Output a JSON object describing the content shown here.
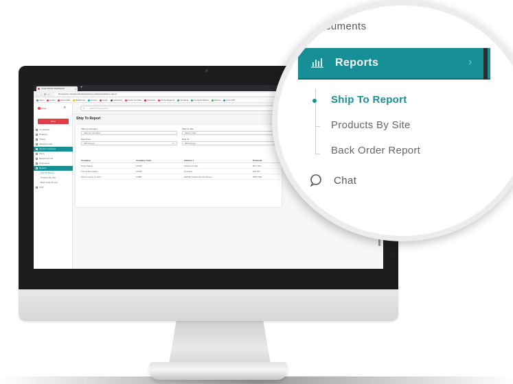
{
  "browser": {
    "tab_title": "Arrow Portal | Dashboard",
    "tab_close": "×",
    "new_tab": "+",
    "nav": [
      "←",
      "→",
      "⟳",
      "⌂"
    ],
    "url": "Not secure | arrowportal.designpixel.co.uk/reports/ship-to-report",
    "bookmarks": [
      {
        "label": "Apps",
        "color": "#4a8bf5"
      },
      {
        "label": "Arrow",
        "color": "#e23c4a"
      },
      {
        "label": "Arrow Mail",
        "color": "#e23c4a"
      },
      {
        "label": "MailChimp",
        "color": "#f5b400"
      },
      {
        "label": "Canva",
        "color": "#00b3c7"
      },
      {
        "label": "Gmail",
        "color": "#e23c4a"
      },
      {
        "label": "Facebook",
        "color": "#3b5998"
      },
      {
        "label": "Arrow YouTube",
        "color": "#e23c4a"
      },
      {
        "label": "Pinterest",
        "color": "#c8232c"
      },
      {
        "label": "Arrow Magento",
        "color": "#e23c4a"
      },
      {
        "label": "Contacts",
        "color": "#34a853"
      },
      {
        "label": "Contacts Master",
        "color": "#34a853"
      },
      {
        "label": "Sheets",
        "color": "#34a853"
      },
      {
        "label": "Free GPT",
        "color": "#10a37f"
      }
    ]
  },
  "app": {
    "logo": "arrow",
    "menu_icon": "≡",
    "shop_button": "Shop",
    "search_icon": "⌕",
    "search_placeholder": "Search Arrow Portal...",
    "page_title": "Ship To Report",
    "sidebar": [
      {
        "label": "Companies",
        "style": "normal"
      },
      {
        "label": "Products",
        "style": "normal"
      },
      {
        "label": "Orders",
        "style": "normal"
      },
      {
        "label": "Shopping Cart",
        "style": "normal"
      },
      {
        "label": "Account Overview",
        "style": "teal"
      },
      {
        "label": "Users",
        "style": "normal"
      },
      {
        "label": "Equipment List",
        "style": "normal"
      },
      {
        "label": "Documents",
        "style": "normal"
      },
      {
        "label": "Reports",
        "style": "teal"
      },
      {
        "label": "Ship To Report",
        "style": "sub-active"
      },
      {
        "label": "Products By Site",
        "style": "sub"
      },
      {
        "label": "Back Order Report",
        "style": "sub"
      },
      {
        "label": "Chat",
        "style": "normal"
      }
    ],
    "filters": {
      "company_label": "Filter by Company",
      "company_value": "Filter by Company",
      "site_label": "Filter by Site",
      "site_value": "Filter by Site",
      "date_from_label": "Date From",
      "date_from_value": "dd/mm/yyyy",
      "date_to_label": "Date To",
      "date_to_value": "dd/mm/yyyy",
      "select_caret": "⌄",
      "calendar_icon": "▭"
    },
    "table": {
      "columns": [
        "Company",
        "Company Code",
        "Address 1",
        "Postcode"
      ],
      "rows": [
        [
          "Direct Safety",
          "C0016",
          "120 Arrow Way",
          "B12 3PH"
        ],
        [
          "Formal Beverages",
          "C0016",
          "Kosmara",
          "EH1 BS"
        ],
        [
          "Prime County Council",
          "C0081",
          "SENSE Gatehouse Cp School",
          "WF8 3NE"
        ]
      ]
    }
  },
  "zoom": {
    "documents": "Documents",
    "reports": "Reports",
    "reports_caret": "›",
    "ship_to_report": "Ship To Report",
    "products_by_site": "Products By Site",
    "back_order_report": "Back Order Report",
    "chat": "Chat",
    "accent_color": "#168f96"
  }
}
